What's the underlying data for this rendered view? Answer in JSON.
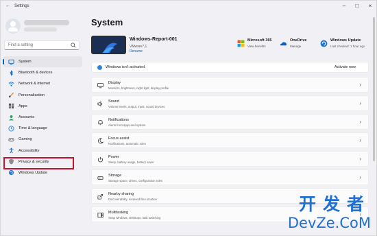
{
  "window": {
    "title": "Settings"
  },
  "sidebar": {
    "search_placeholder": "Find a setting",
    "items": [
      {
        "label": "System",
        "icon": "system-icon",
        "active": true
      },
      {
        "label": "Bluetooth & devices",
        "icon": "bluetooth-icon"
      },
      {
        "label": "Network & internet",
        "icon": "network-icon"
      },
      {
        "label": "Personalization",
        "icon": "brush-icon"
      },
      {
        "label": "Apps",
        "icon": "apps-icon"
      },
      {
        "label": "Accounts",
        "icon": "accounts-icon"
      },
      {
        "label": "Time & language",
        "icon": "globe-clock-icon"
      },
      {
        "label": "Gaming",
        "icon": "gamepad-icon"
      },
      {
        "label": "Accessibility",
        "icon": "accessibility-icon"
      },
      {
        "label": "Privacy & security",
        "icon": "shield-icon"
      },
      {
        "label": "Windows Update",
        "icon": "windows-update-icon"
      }
    ]
  },
  "main": {
    "title": "System",
    "device": {
      "name": "Windows-Report-001",
      "model": "VMware7,1",
      "rename": "Rename"
    },
    "quick_links": [
      {
        "title": "Microsoft 365",
        "sub": "View benefits",
        "icon": "microsoft365-icon"
      },
      {
        "title": "OneDrive",
        "sub": "Manage",
        "icon": "onedrive-icon"
      },
      {
        "title": "Windows Update",
        "sub": "Last checked: 1 hour ago",
        "icon": "windows-update-icon"
      }
    ],
    "activation": {
      "message": "Windows isn't activated.",
      "action": "Activate now"
    },
    "cards": [
      {
        "title": "Display",
        "sub": "Monitors, brightness, night light, display profile",
        "icon": "display-icon"
      },
      {
        "title": "Sound",
        "sub": "Volume levels, output, input, sound devices",
        "icon": "sound-icon"
      },
      {
        "title": "Notifications",
        "sub": "Alerts from apps and system",
        "icon": "bell-icon"
      },
      {
        "title": "Focus assist",
        "sub": "Notifications, automatic rules",
        "icon": "moon-icon"
      },
      {
        "title": "Power",
        "sub": "Sleep, battery usage, battery saver",
        "icon": "power-icon"
      },
      {
        "title": "Storage",
        "sub": "Storage space, drives, configuration rules",
        "icon": "storage-icon"
      },
      {
        "title": "Nearby sharing",
        "sub": "Discoverability, received files location",
        "icon": "share-icon"
      },
      {
        "title": "Multitasking",
        "sub": "Snap windows, desktops, task switching",
        "icon": "multitask-icon"
      }
    ]
  },
  "watermark": {
    "line1": "开发者",
    "line2": "DevZe.CoM"
  },
  "colors": {
    "accent": "#0067c0",
    "highlight": "#c8102e",
    "watermark": "#1f6fd4"
  }
}
